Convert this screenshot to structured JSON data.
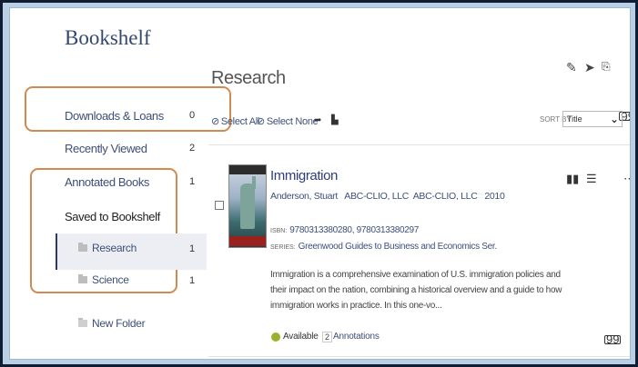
{
  "sidebar": {
    "title": "Bookshelf",
    "items": [
      {
        "label": "Downloads & Loans",
        "count": "0"
      },
      {
        "label": "Recently Viewed",
        "count": "2"
      },
      {
        "label": "Annotated Books",
        "count": "1"
      },
      {
        "label": "Saved to Bookshelf",
        "count": ""
      }
    ],
    "folders": [
      {
        "label": "Research",
        "count": "1",
        "active": true
      },
      {
        "label": "Science",
        "count": "1",
        "active": false
      }
    ],
    "new_folder_label": "New Folder"
  },
  "main": {
    "title": "Research",
    "top_icons": [
      "edit-icon",
      "send-icon",
      "export-icon",
      "citation-icon"
    ],
    "toolbar": {
      "select_all": "Select All",
      "select_none": "Select None",
      "move_icon": "arrow-right-icon",
      "folder_move_icon": "folder-move-icon"
    },
    "sort": {
      "label": "SORT BY",
      "value": "Title"
    }
  },
  "book": {
    "title": "Immigration",
    "authors": "Anderson, Stuart   ABC-CLIO, LLC  ABC-CLIO, LLC   2010",
    "isbn_label": "ISBN:",
    "isbn": "9780313380280, 9780313380297",
    "series_label": "SERIES:",
    "series": "Greenwood Guides to Business and Economics Ser.",
    "description": "Immigration is a comprehensive examination of U.S. immigration policies and their impact on the nation, combining a historical overview and a guide to how immigration works in practice. In this one-vo...",
    "availability": "Available",
    "annotation_count": "2",
    "annotation_label": "Annotations",
    "action_icons": [
      "read-icon",
      "list-icon",
      "citation-icon",
      "more-icon"
    ]
  },
  "colors": {
    "accent": "#2c3e7a",
    "highlight_box": "#d08a52",
    "available": "#9cb22e"
  }
}
